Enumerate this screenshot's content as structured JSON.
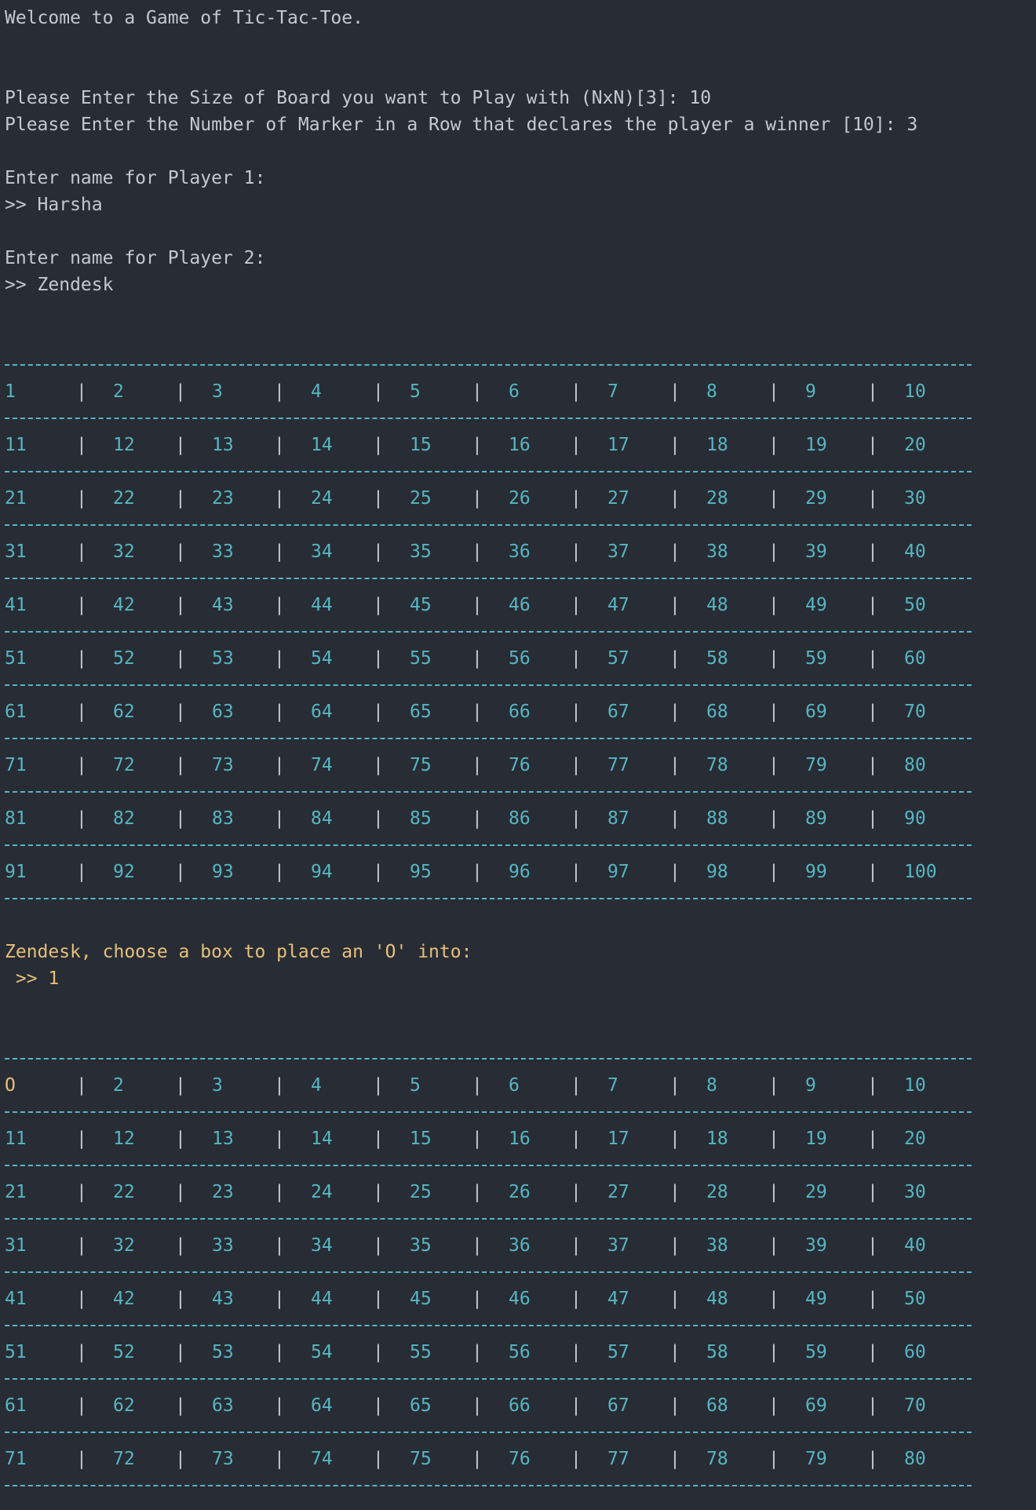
{
  "intro": {
    "welcome": "Welcome to a Game of Tic-Tac-Toe.",
    "size_prompt": "Please Enter the Size of Board you want to Play with (NxN)[3]: 10",
    "win_prompt": "Please Enter the Number of Marker in a Row that declares the player a winner [10]: 3",
    "p1_prompt": "Enter name for Player 1:",
    "p1_input": ">> Harsha",
    "p2_prompt": "Enter name for Player 2:",
    "p2_input": ">> Zendesk"
  },
  "colors": {
    "background": "#282c34",
    "text": "#c5c9cf",
    "board": "#56b6c2",
    "prompt": "#e5c07b"
  },
  "board1": {
    "rows": [
      [
        "1",
        "2",
        "3",
        "4",
        "5",
        "6",
        "7",
        "8",
        "9",
        "10"
      ],
      [
        "11",
        "12",
        "13",
        "14",
        "15",
        "16",
        "17",
        "18",
        "19",
        "20"
      ],
      [
        "21",
        "22",
        "23",
        "24",
        "25",
        "26",
        "27",
        "28",
        "29",
        "30"
      ],
      [
        "31",
        "32",
        "33",
        "34",
        "35",
        "36",
        "37",
        "38",
        "39",
        "40"
      ],
      [
        "41",
        "42",
        "43",
        "44",
        "45",
        "46",
        "47",
        "48",
        "49",
        "50"
      ],
      [
        "51",
        "52",
        "53",
        "54",
        "55",
        "56",
        "57",
        "58",
        "59",
        "60"
      ],
      [
        "61",
        "62",
        "63",
        "64",
        "65",
        "66",
        "67",
        "68",
        "69",
        "70"
      ],
      [
        "71",
        "72",
        "73",
        "74",
        "75",
        "76",
        "77",
        "78",
        "79",
        "80"
      ],
      [
        "81",
        "82",
        "83",
        "84",
        "85",
        "86",
        "87",
        "88",
        "89",
        "90"
      ],
      [
        "91",
        "92",
        "93",
        "94",
        "95",
        "96",
        "97",
        "98",
        "99",
        "100"
      ]
    ]
  },
  "turn": {
    "prompt": "Zendesk, choose a box to place an 'O' into:",
    "input": " >> 1"
  },
  "board2": {
    "rows": [
      [
        "O",
        "2",
        "3",
        "4",
        "5",
        "6",
        "7",
        "8",
        "9",
        "10"
      ],
      [
        "11",
        "12",
        "13",
        "14",
        "15",
        "16",
        "17",
        "18",
        "19",
        "20"
      ],
      [
        "21",
        "22",
        "23",
        "24",
        "25",
        "26",
        "27",
        "28",
        "29",
        "30"
      ],
      [
        "31",
        "32",
        "33",
        "34",
        "35",
        "36",
        "37",
        "38",
        "39",
        "40"
      ],
      [
        "41",
        "42",
        "43",
        "44",
        "45",
        "46",
        "47",
        "48",
        "49",
        "50"
      ],
      [
        "51",
        "52",
        "53",
        "54",
        "55",
        "56",
        "57",
        "58",
        "59",
        "60"
      ],
      [
        "61",
        "62",
        "63",
        "64",
        "65",
        "66",
        "67",
        "68",
        "69",
        "70"
      ],
      [
        "71",
        "72",
        "73",
        "74",
        "75",
        "76",
        "77",
        "78",
        "79",
        "80"
      ]
    ]
  }
}
